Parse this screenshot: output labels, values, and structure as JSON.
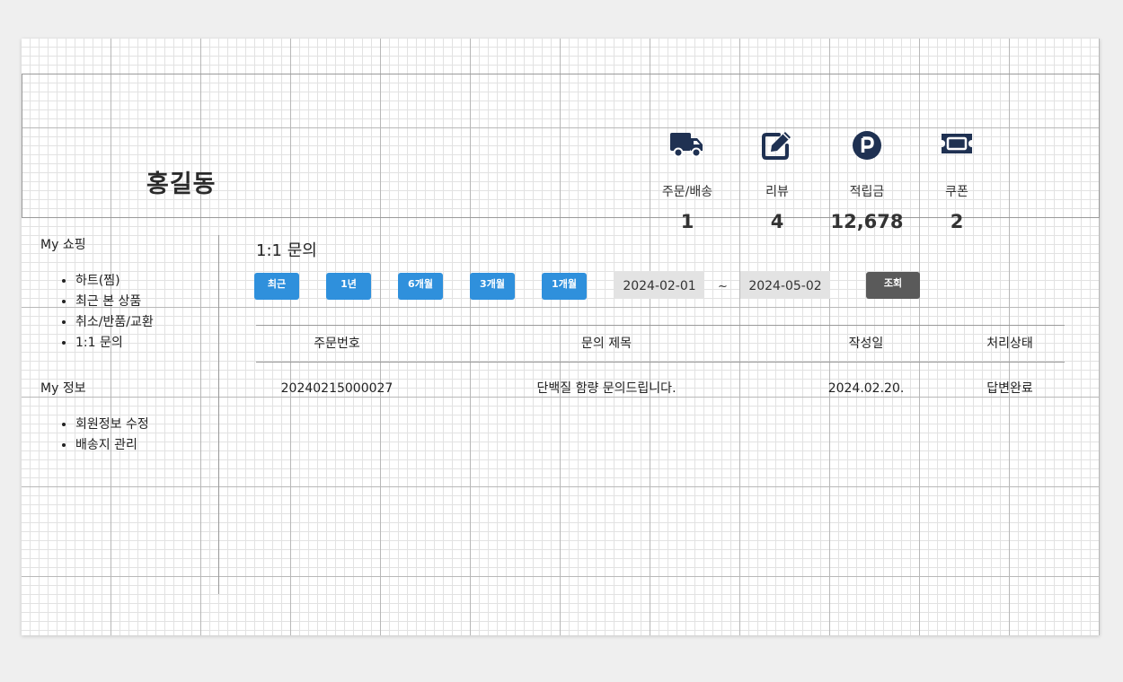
{
  "user": {
    "name": "홍길동"
  },
  "stats": [
    {
      "icon": "truck-icon",
      "label": "주문/배송",
      "count": "1"
    },
    {
      "icon": "edit-icon",
      "label": "리뷰",
      "count": "4"
    },
    {
      "icon": "points-icon",
      "label": "적립금",
      "count": "12,678"
    },
    {
      "icon": "ticket-icon",
      "label": "쿠폰",
      "count": "2"
    }
  ],
  "sidebar": {
    "shopping_title": "My 쇼핑",
    "shopping_items": [
      "하트(찜)",
      "최근 본 상품",
      "취소/반품/교환",
      "1:1 문의"
    ],
    "info_title": "My 정보",
    "info_items": [
      "회원정보 수정",
      "배송지 관리"
    ]
  },
  "main": {
    "title": "1:1 문의",
    "filters": [
      "최근",
      "1년",
      "6개월",
      "3개월",
      "1개월"
    ],
    "date_from": "2024-02-01",
    "date_separator": "~",
    "date_to": "2024-05-02",
    "search_label": "조회"
  },
  "table": {
    "headers": [
      "주문번호",
      "문의 제목",
      "작성일",
      "처리상태"
    ],
    "rows": [
      [
        "20240215000027",
        "단백질 함량 문의드립니다.",
        "2024.02.20.",
        "답변완료"
      ]
    ]
  },
  "colors": {
    "icon": "#1f3152",
    "filter_button": "#2f90dc",
    "search_button": "#5a5a5a",
    "date_box": "#e3e3e3"
  }
}
